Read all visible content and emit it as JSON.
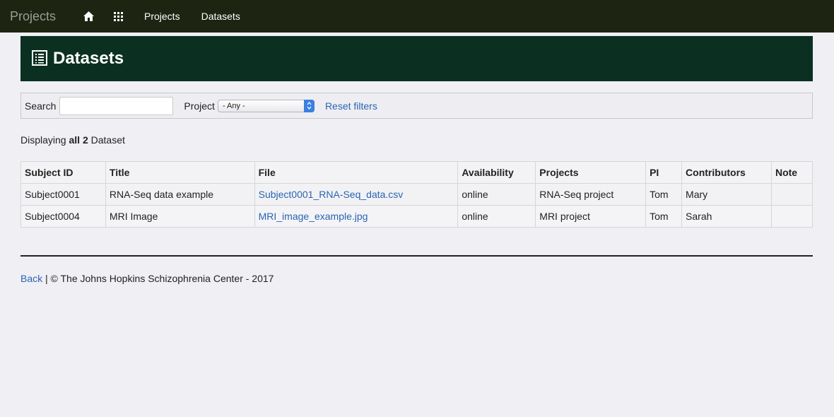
{
  "navbar": {
    "brand": "Projects",
    "icons": [
      "home-icon",
      "grid-icon"
    ],
    "links": [
      "Projects",
      "Datasets"
    ]
  },
  "banner": {
    "title": "Datasets",
    "icon": "list-icon"
  },
  "filters": {
    "search_label": "Search",
    "search_value": "",
    "project_label": "Project",
    "project_selected": "- Any -",
    "reset_label": "Reset filters"
  },
  "summary": {
    "prefix": "Displaying ",
    "bold": "all 2",
    "suffix": " Dataset"
  },
  "table": {
    "headers": [
      "Subject ID",
      "Title",
      "File",
      "Availability",
      "Projects",
      "PI",
      "Contributors",
      "Note"
    ],
    "rows": [
      [
        "Subject0001",
        "RNA-Seq data example",
        "Subject0001_RNA-Seq_data.csv",
        "online",
        "RNA-Seq project",
        "Tom",
        "Mary",
        ""
      ],
      [
        "Subject0004",
        "MRI Image",
        "MRI_image_example.jpg",
        "online",
        "MRI project",
        "Tom",
        "Sarah",
        ""
      ]
    ]
  },
  "footer": {
    "back": "Back",
    "text": " | © The Johns Hopkins Schizophrenia Center - 2017"
  },
  "colors": {
    "navbar": "#1d2412",
    "banner": "#0b3021",
    "link": "#2a64b4",
    "background": "#efeff4"
  }
}
